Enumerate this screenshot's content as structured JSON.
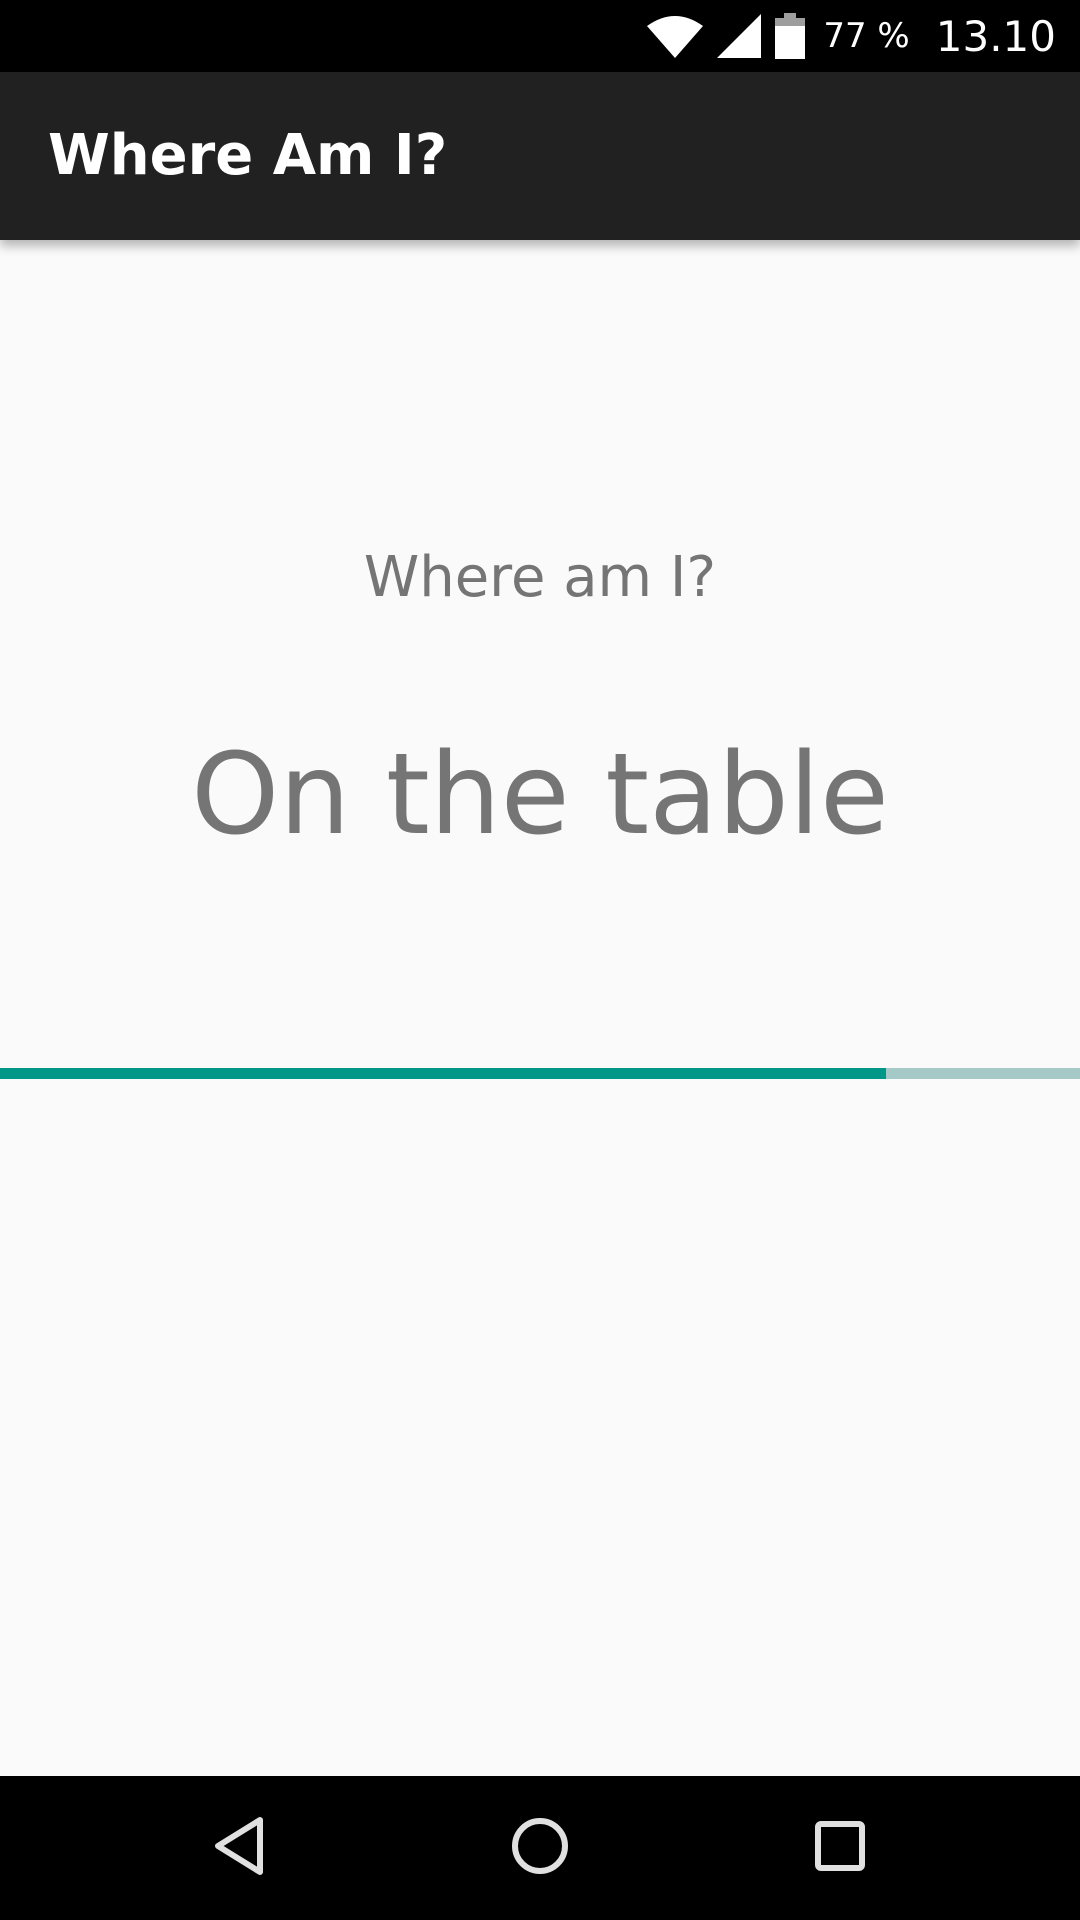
{
  "status_bar": {
    "battery": "77 %",
    "time": "13.10",
    "icons": [
      "wifi-icon",
      "cell-signal-icon",
      "battery-icon"
    ]
  },
  "app_bar": {
    "title": "Where Am I?"
  },
  "main": {
    "question": "Where am I?",
    "answer": "On the table",
    "progress": 0.82
  },
  "nav_bar": {
    "icons": [
      "back-icon",
      "home-icon",
      "recents-icon"
    ]
  },
  "colors": {
    "app_bar": "#212121",
    "accent": "#009688",
    "progress_track": "#a4c9c6",
    "text_secondary": "#757575",
    "background": "#fafafa"
  }
}
